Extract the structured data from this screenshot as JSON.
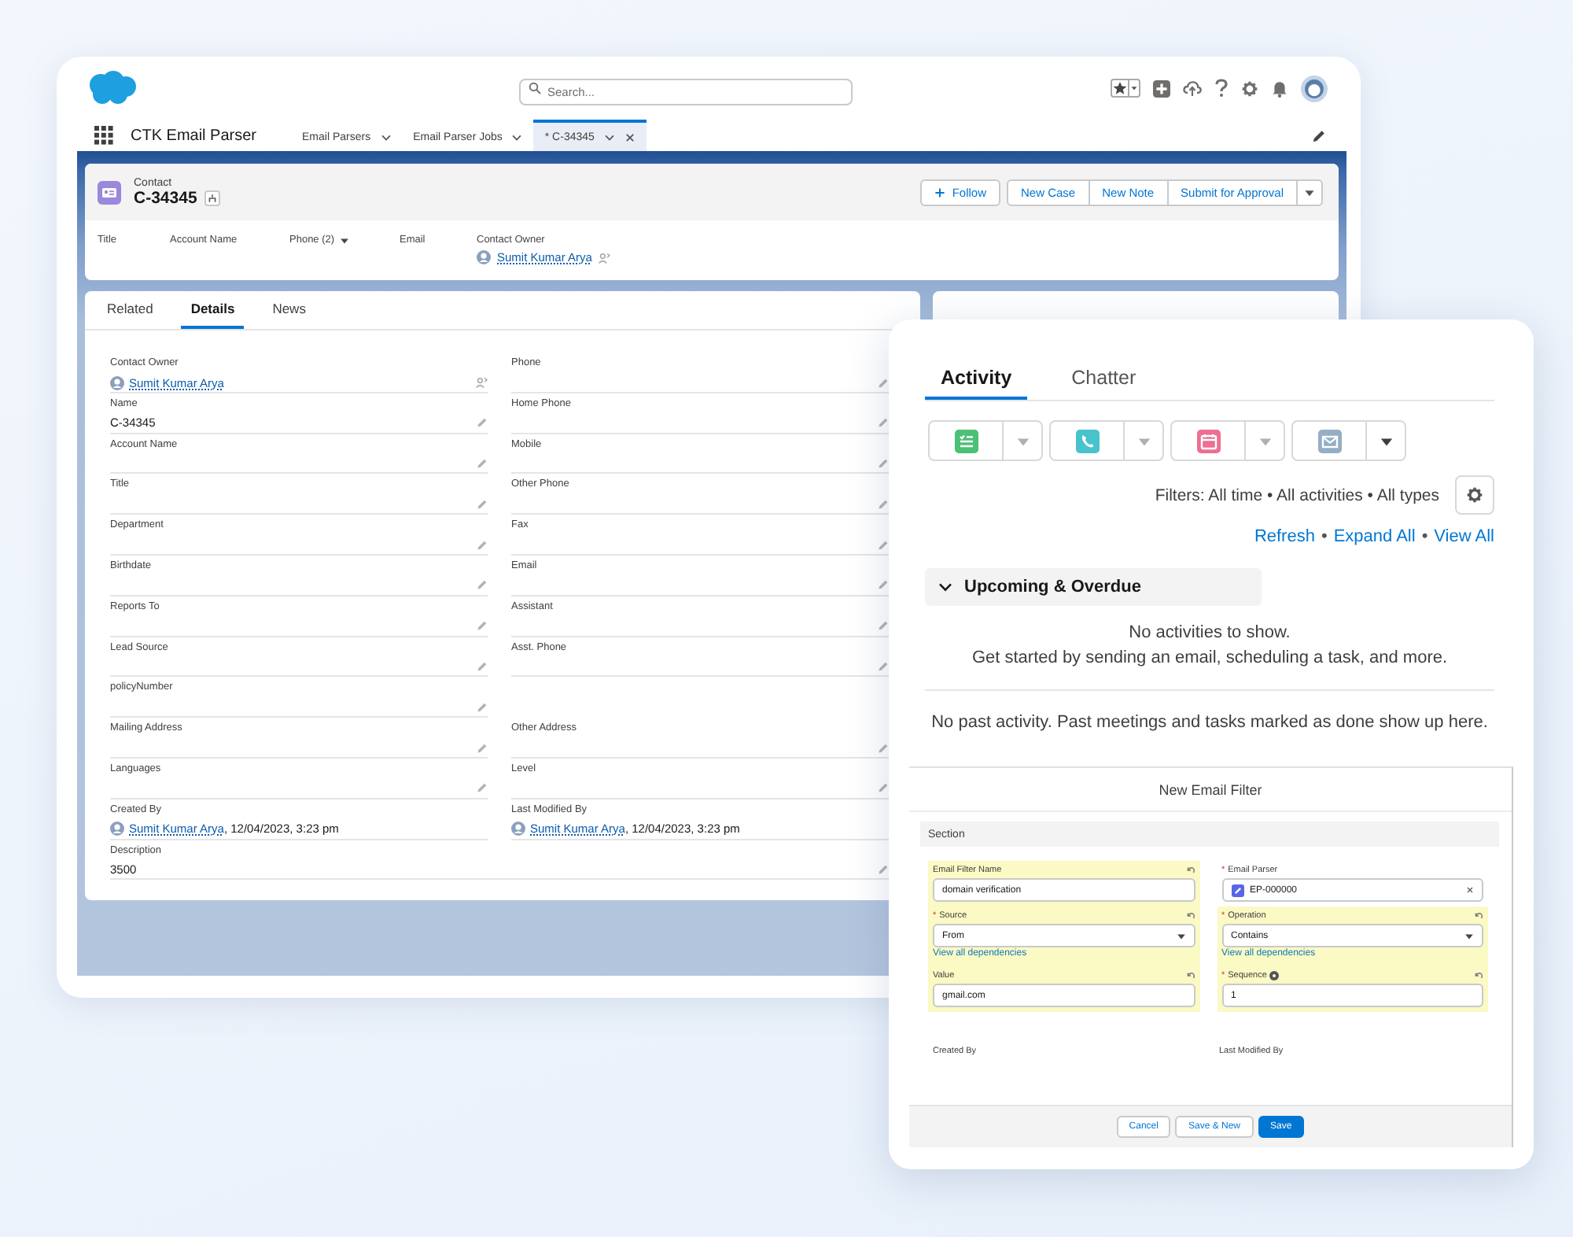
{
  "global_header": {
    "search": {
      "placeholder": "Search..."
    }
  },
  "app_name": "CTK Email Parser",
  "nav_tabs": [
    {
      "label": "Email Parsers",
      "selected": false,
      "closable": false
    },
    {
      "label": "Email Parser Jobs",
      "selected": false,
      "closable": false
    },
    {
      "label": "* C-34345",
      "selected": true,
      "closable": true
    }
  ],
  "record": {
    "object_type": "Contact",
    "name": "C-34345",
    "actions": [
      {
        "label": "Follow",
        "kind": "follow"
      },
      {
        "label": "New Case",
        "kind": "grouped"
      },
      {
        "label": "New Note",
        "kind": "grouped"
      },
      {
        "label": "Submit for Approval",
        "kind": "grouped"
      }
    ],
    "highlights": [
      {
        "label": "Title",
        "kind": "plain"
      },
      {
        "label": "Account Name",
        "kind": "plain"
      },
      {
        "label": "Phone (2)",
        "kind": "dropdown"
      },
      {
        "label": "Email",
        "kind": "plain"
      },
      {
        "label": "Contact Owner",
        "kind": "user",
        "value": "Sumit Kumar Arya"
      }
    ]
  },
  "details": {
    "tabs": [
      {
        "label": "Related",
        "selected": false
      },
      {
        "label": "Details",
        "selected": true
      },
      {
        "label": "News",
        "selected": false
      }
    ],
    "rows": [
      {
        "left": {
          "label": "Contact Owner",
          "kind": "user",
          "value": "Sumit Kumar Arya",
          "editable": false,
          "owner_change": true
        },
        "right": {
          "label": "Phone",
          "kind": "text",
          "editable": true
        }
      },
      {
        "left": {
          "label": "Name",
          "kind": "text",
          "value": "C-34345",
          "editable": true
        },
        "right": {
          "label": "Home Phone",
          "kind": "text",
          "editable": true
        }
      },
      {
        "left": {
          "label": "Account Name",
          "kind": "text",
          "editable": true
        },
        "right": {
          "label": "Mobile",
          "kind": "text",
          "editable": true
        }
      },
      {
        "left": {
          "label": "Title",
          "kind": "text",
          "editable": true
        },
        "right": {
          "label": "Other Phone",
          "kind": "text",
          "editable": true
        }
      },
      {
        "left": {
          "label": "Department",
          "kind": "text",
          "editable": true
        },
        "right": {
          "label": "Fax",
          "kind": "text",
          "editable": true
        }
      },
      {
        "left": {
          "label": "Birthdate",
          "kind": "text",
          "editable": true
        },
        "right": {
          "label": "Email",
          "kind": "text",
          "editable": true
        }
      },
      {
        "left": {
          "label": "Reports To",
          "kind": "text",
          "editable": true
        },
        "right": {
          "label": "Assistant",
          "kind": "text",
          "editable": true
        }
      },
      {
        "left": {
          "label": "Lead Source",
          "kind": "text",
          "editable": true
        },
        "right": {
          "label": "Asst. Phone",
          "kind": "text",
          "editable": true
        }
      },
      {
        "left": {
          "label": "policyNumber",
          "kind": "text",
          "editable": true
        }
      },
      {
        "left": {
          "label": "Mailing Address",
          "kind": "text",
          "editable": true
        },
        "right": {
          "label": "Other Address",
          "kind": "text",
          "editable": true
        }
      },
      {
        "left": {
          "label": "Languages",
          "kind": "text",
          "editable": true
        },
        "right": {
          "label": "Level",
          "kind": "text",
          "editable": true
        }
      },
      {
        "left": {
          "label": "Created By",
          "kind": "user",
          "value": "Sumit Kumar Arya",
          "suffix": ", 12/04/2023, 3:23 pm",
          "editable": false
        },
        "right": {
          "label": "Last Modified By",
          "kind": "user",
          "value": "Sumit Kumar Arya",
          "suffix": ", 12/04/2023, 3:23 pm",
          "editable": false
        }
      },
      {
        "left": {
          "label": "Description",
          "kind": "text",
          "value": "3500",
          "editable": true,
          "wide": true
        }
      }
    ]
  },
  "activity": {
    "tabs": [
      {
        "label": "Activity",
        "selected": true
      },
      {
        "label": "Chatter",
        "selected": false
      }
    ],
    "composer": [
      {
        "kind": "task",
        "color": "#4bc076",
        "menu_disabled": true
      },
      {
        "kind": "call",
        "color": "#48c3cc",
        "menu_disabled": true
      },
      {
        "kind": "event",
        "color": "#eb7092",
        "menu_disabled": true
      },
      {
        "kind": "email",
        "color": "#95aec5",
        "menu_disabled": false
      }
    ],
    "filters": "Filters: All time • All activities • All types",
    "links": [
      "Refresh",
      "Expand All",
      "View All"
    ],
    "link_separator": "•",
    "section": {
      "title": "Upcoming & Overdue",
      "expanded": true
    },
    "empty_lines": [
      "No activities to show.",
      "Get started by sending an email, scheduling a task, and more."
    ],
    "past_message": "No past activity. Past meetings and tasks marked as done show up here."
  },
  "email_filter_modal": {
    "title": "New Email Filter",
    "section": "Section",
    "required_mark": "*",
    "fields": [
      {
        "label": "Email Filter Name",
        "kind": "text",
        "value": "domain verification",
        "required": false,
        "changed": true
      },
      {
        "label": "Email Parser",
        "kind": "lookup",
        "value": "EP-000000",
        "required": true,
        "changed": false
      },
      {
        "label": "Source",
        "kind": "picklist",
        "value": "From",
        "required": true,
        "changed": true,
        "link": "View all dependencies"
      },
      {
        "label": "Operation",
        "kind": "picklist",
        "value": "Contains",
        "required": true,
        "changed": true,
        "link": "View all dependencies"
      },
      {
        "label": "Value",
        "kind": "text",
        "value": "gmail.com",
        "required": false,
        "changed": true
      },
      {
        "label": "Sequence",
        "kind": "text",
        "value": "1",
        "required": true,
        "changed": true,
        "help": true
      }
    ],
    "system_fields": [
      "Created By",
      "Last Modified By"
    ],
    "buttons": [
      {
        "label": "Cancel",
        "kind": "neutral"
      },
      {
        "label": "Save & New",
        "kind": "neutral"
      },
      {
        "label": "Save",
        "kind": "brand"
      }
    ]
  }
}
